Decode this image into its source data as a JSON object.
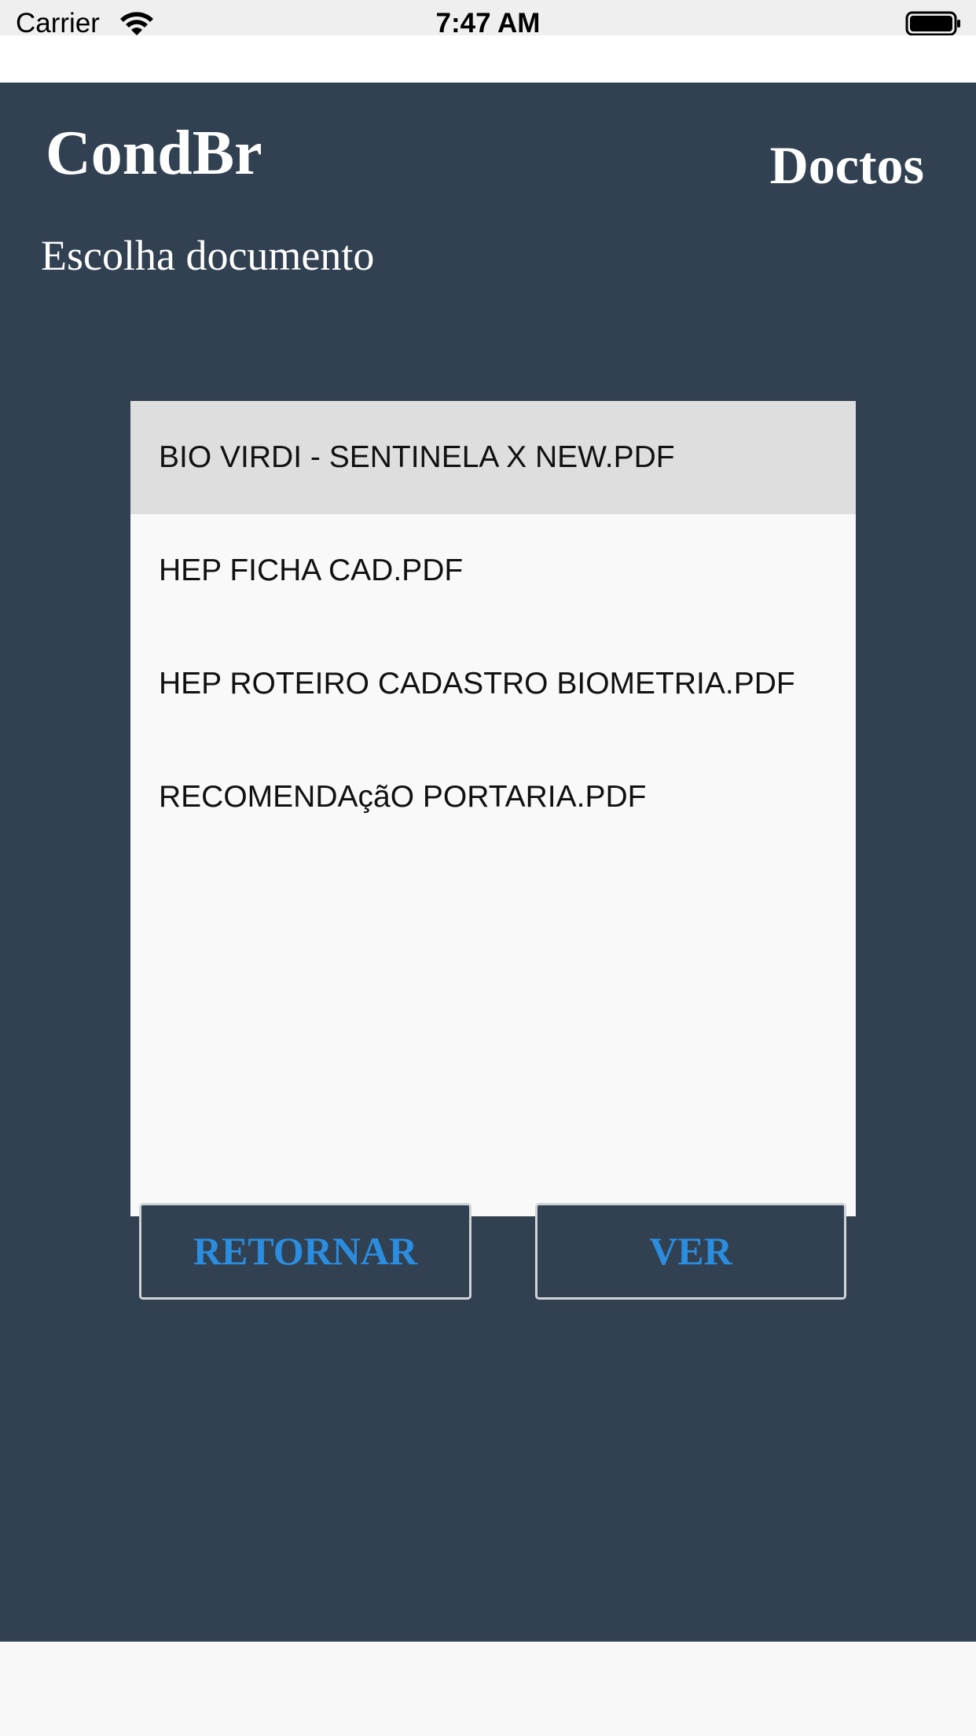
{
  "status_bar": {
    "carrier": "Carrier",
    "time": "7:47 AM",
    "icons": [
      "wifi-icon",
      "battery-icon"
    ]
  },
  "header": {
    "app_title": "CondBr",
    "section_title": "Doctos",
    "subtitle": "Escolha documento"
  },
  "documents": {
    "items": [
      {
        "label": "BIO VIRDI - SENTINELA X NEW.PDF",
        "selected": true
      },
      {
        "label": "HEP FICHA CAD.PDF",
        "selected": false
      },
      {
        "label": "HEP ROTEIRO CADASTRO BIOMETRIA.PDF",
        "selected": false
      },
      {
        "label": "RECOMENDAçãO PORTARIA.PDF",
        "selected": false
      }
    ]
  },
  "actions": {
    "return_label": "RETORNAR",
    "view_label": "VER"
  },
  "colors": {
    "background": "#324151",
    "button_text": "#2a8de0",
    "list_background": "#f9f9f9",
    "selected_row": "#dedede"
  }
}
